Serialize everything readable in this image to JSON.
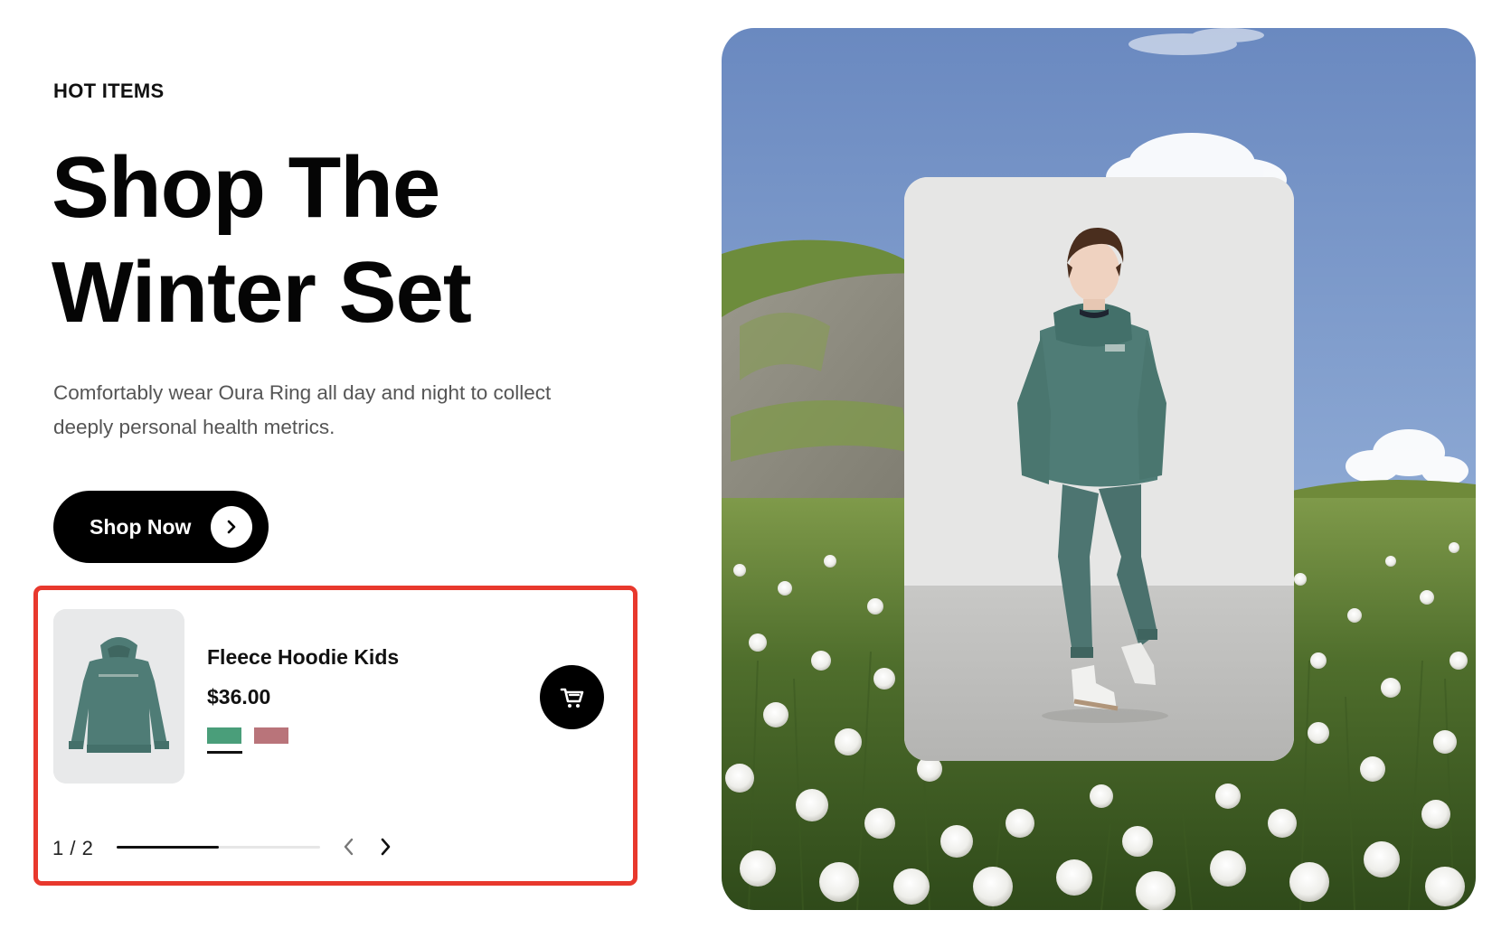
{
  "hero_section": {
    "eyebrow": "HOT ITEMS",
    "headline": "Shop The Winter Set",
    "description": "Comfortably wear Oura Ring all day and night to collect deeply personal health metrics.",
    "cta_label": "Shop Now",
    "cta_icon": "chevron-right-icon"
  },
  "product_carousel": {
    "product": {
      "name": "Fleece Hoodie Kids",
      "price": "$36.00",
      "image_icon": "hoodie-thumbnail",
      "swatches": [
        {
          "name": "green",
          "color": "#4a9e7a",
          "selected": true
        },
        {
          "name": "rose",
          "color": "#b9747a",
          "selected": false
        }
      ]
    },
    "cart_icon": "cart-icon",
    "pagination": {
      "label": "1 / 2",
      "current": 1,
      "total": 2,
      "progress": 0.5
    },
    "prev_icon": "chevron-left-icon",
    "next_icon": "chevron-right-icon"
  },
  "hero_image": {
    "scene": "meadow-with-cotton-grass",
    "model_image": "kid-in-green-tracksuit"
  },
  "colors": {
    "highlight_border": "#e8382d",
    "button_bg": "#000000",
    "hoodie_green": "#4f7c76",
    "sky": "#7a98c7"
  }
}
